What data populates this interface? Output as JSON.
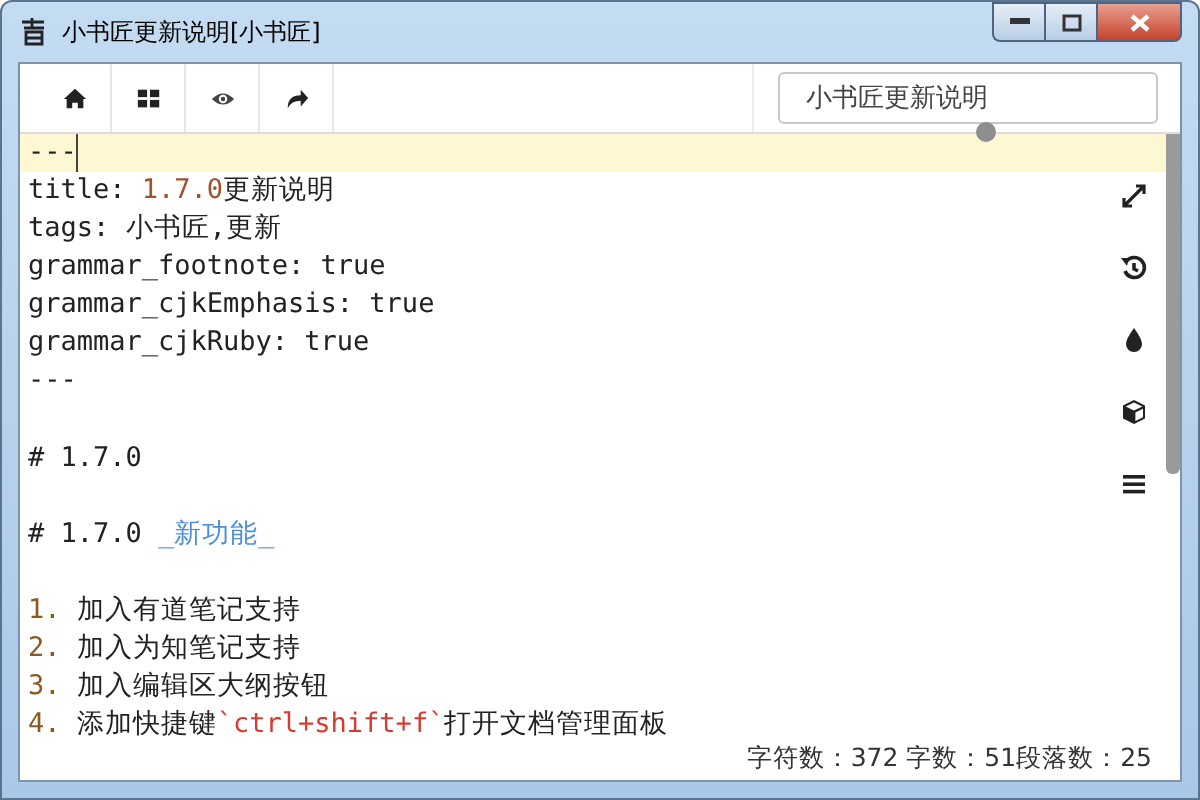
{
  "window": {
    "title": "小书匠更新说明[小书匠]"
  },
  "toolbar": {
    "search": {
      "value": "小书匠更新说明"
    }
  },
  "editor": {
    "lines": [
      {
        "kind": "text",
        "current": true,
        "segments": [
          {
            "text": "---",
            "kind": "plain"
          }
        ]
      },
      {
        "kind": "text",
        "current": false,
        "segments": [
          {
            "text": "title: ",
            "kind": "plain"
          },
          {
            "text": "1.7.0",
            "kind": "value"
          },
          {
            "text": "更新说明",
            "kind": "plain"
          }
        ]
      },
      {
        "kind": "text",
        "current": false,
        "segments": [
          {
            "text": "tags: 小书匠,更新",
            "kind": "plain"
          }
        ]
      },
      {
        "kind": "text",
        "current": false,
        "segments": [
          {
            "text": "grammar_footnote: true",
            "kind": "plain"
          }
        ]
      },
      {
        "kind": "text",
        "current": false,
        "segments": [
          {
            "text": "grammar_cjkEmphasis: true",
            "kind": "plain"
          }
        ]
      },
      {
        "kind": "text",
        "current": false,
        "segments": [
          {
            "text": "grammar_cjkRuby: true",
            "kind": "plain"
          }
        ]
      },
      {
        "kind": "text",
        "current": false,
        "segments": [
          {
            "text": "---",
            "kind": "plain"
          }
        ]
      },
      {
        "kind": "blank",
        "current": false
      },
      {
        "kind": "text",
        "current": false,
        "segments": [
          {
            "text": "# 1.7.0",
            "kind": "plain"
          }
        ]
      },
      {
        "kind": "blank",
        "current": false
      },
      {
        "kind": "text",
        "current": false,
        "segments": [
          {
            "text": "# 1.7.0 ",
            "kind": "plain"
          },
          {
            "text": "_新功能_",
            "kind": "em"
          }
        ]
      },
      {
        "kind": "blank",
        "current": false
      },
      {
        "kind": "text",
        "current": false,
        "segments": [
          {
            "text": "1.",
            "kind": "marker"
          },
          {
            "text": " 加入有道笔记支持",
            "kind": "plain"
          }
        ]
      },
      {
        "kind": "text",
        "current": false,
        "segments": [
          {
            "text": "2.",
            "kind": "marker"
          },
          {
            "text": " 加入为知笔记支持",
            "kind": "plain"
          }
        ]
      },
      {
        "kind": "text",
        "current": false,
        "segments": [
          {
            "text": "3.",
            "kind": "marker"
          },
          {
            "text": " 加入编辑区大纲按钮",
            "kind": "plain"
          }
        ]
      },
      {
        "kind": "text",
        "current": false,
        "segments": [
          {
            "text": "4.",
            "kind": "marker"
          },
          {
            "text": " 添加快捷键",
            "kind": "plain"
          },
          {
            "text": "`ctrl+shift+f`",
            "kind": "code"
          },
          {
            "text": "打开文档管理面板",
            "kind": "plain"
          }
        ]
      }
    ]
  },
  "status_bar": {
    "text": "字符数：372 字数：51段落数：25"
  }
}
